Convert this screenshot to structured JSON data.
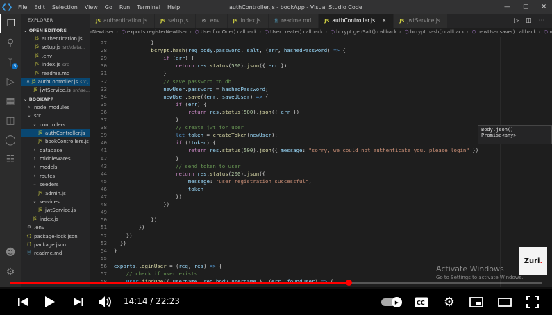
{
  "titlebar": {
    "menu": [
      "File",
      "Edit",
      "Selection",
      "View",
      "Go",
      "Run",
      "Terminal",
      "Help"
    ],
    "window_title": "authController.js - bookApp - Visual Studio Code"
  },
  "activity_badge": "5",
  "sidebar": {
    "title": "EXPLORER",
    "open_editors_header": "OPEN EDITORS",
    "open_editors": [
      {
        "name": "authentication.js",
        "desc": "",
        "selected": false
      },
      {
        "name": "setup.js",
        "desc": "src\\data...",
        "selected": false
      },
      {
        "name": ".env",
        "desc": "",
        "selected": false
      },
      {
        "name": "index.js",
        "desc": "src",
        "selected": false
      },
      {
        "name": "readme.md",
        "desc": "",
        "selected": false
      },
      {
        "name": "authController.js",
        "desc": "src\\...",
        "selected": true
      },
      {
        "name": "jwtService.js",
        "desc": "src\\se...",
        "selected": false
      }
    ],
    "project_header": "BOOKAPP",
    "tree": [
      {
        "name": "node_modules",
        "type": "folder",
        "depth": 1,
        "active": false
      },
      {
        "name": "src",
        "type": "folder-open",
        "depth": 1,
        "active": false
      },
      {
        "name": "controllers",
        "type": "folder-open",
        "depth": 2,
        "active": false
      },
      {
        "name": "authController.js",
        "type": "js",
        "depth": 3,
        "active": true
      },
      {
        "name": "bookControllers.js",
        "type": "js",
        "depth": 3,
        "active": false
      },
      {
        "name": "database",
        "type": "folder",
        "depth": 2,
        "active": false
      },
      {
        "name": "middlewares",
        "type": "folder",
        "depth": 2,
        "active": false
      },
      {
        "name": "models",
        "type": "folder",
        "depth": 2,
        "active": false
      },
      {
        "name": "routes",
        "type": "folder",
        "depth": 2,
        "active": false
      },
      {
        "name": "seeders",
        "type": "folder-open",
        "depth": 2,
        "active": false
      },
      {
        "name": "admin.js",
        "type": "js",
        "depth": 3,
        "active": false
      },
      {
        "name": "services",
        "type": "folder-open",
        "depth": 2,
        "active": false
      },
      {
        "name": "jwtService.js",
        "type": "js",
        "depth": 3,
        "active": false
      },
      {
        "name": "index.js",
        "type": "js",
        "depth": 2,
        "active": false
      },
      {
        "name": ".env",
        "type": "env",
        "depth": 1,
        "active": false
      },
      {
        "name": "package-lock.json",
        "type": "json",
        "depth": 1,
        "active": false
      },
      {
        "name": "package.json",
        "type": "json",
        "depth": 1,
        "active": false
      },
      {
        "name": "readme.md",
        "type": "md",
        "depth": 1,
        "active": false
      }
    ]
  },
  "tabs": [
    {
      "label": "authentication.js",
      "kind": "JS",
      "active": false
    },
    {
      "label": "setup.js",
      "kind": "JS",
      "active": false
    },
    {
      "label": ".env",
      "kind": "env",
      "active": false
    },
    {
      "label": "index.js",
      "kind": "JS",
      "active": false
    },
    {
      "label": "readme.md",
      "kind": "md",
      "active": false
    },
    {
      "label": "authController.js",
      "kind": "JS",
      "active": true
    },
    {
      "label": "jwtService.js",
      "kind": "JS",
      "active": false
    }
  ],
  "breadcrumbs": [
    "rNewUser",
    "exports.registerNewUser",
    "User.findOne() callback",
    "User.create() callback",
    "bcrypt.genSalt() callback",
    "bcrypt.hash() callback",
    "newUser.save() callback",
    "message"
  ],
  "code_lines": [
    {
      "num": "27",
      "tokens": [
        [
          "p",
          "            }"
        ]
      ]
    },
    {
      "num": "28",
      "tokens": [
        [
          "p",
          "            "
        ],
        [
          "f",
          "bcrypt"
        ],
        [
          "p",
          "."
        ],
        [
          "f",
          "hash"
        ],
        [
          "p",
          "("
        ],
        [
          "v",
          "req"
        ],
        [
          "p",
          "."
        ],
        [
          "v",
          "body"
        ],
        [
          "p",
          "."
        ],
        [
          "v",
          "password"
        ],
        [
          "p",
          ", "
        ],
        [
          "v",
          "salt"
        ],
        [
          "p",
          ", ("
        ],
        [
          "v",
          "err"
        ],
        [
          "p",
          ", "
        ],
        [
          "v",
          "hashedPassword"
        ],
        [
          "p",
          ") "
        ],
        [
          "k",
          "=>"
        ],
        [
          "p",
          " {"
        ]
      ]
    },
    {
      "num": "29",
      "tokens": [
        [
          "p",
          "                "
        ],
        [
          "kw",
          "if"
        ],
        [
          "p",
          " ("
        ],
        [
          "v",
          "err"
        ],
        [
          "p",
          ") {"
        ]
      ]
    },
    {
      "num": "30",
      "tokens": [
        [
          "p",
          "                    "
        ],
        [
          "kw",
          "return"
        ],
        [
          "p",
          " "
        ],
        [
          "v",
          "res"
        ],
        [
          "p",
          "."
        ],
        [
          "f",
          "status"
        ],
        [
          "p",
          "("
        ],
        [
          "n",
          "500"
        ],
        [
          "p",
          ")."
        ],
        [
          "f",
          "json"
        ],
        [
          "p",
          "({ "
        ],
        [
          "v",
          "err"
        ],
        [
          "p",
          " })"
        ]
      ]
    },
    {
      "num": "31",
      "tokens": [
        [
          "p",
          "                }"
        ]
      ]
    },
    {
      "num": "32",
      "tokens": [
        [
          "c",
          "                // save password to db"
        ]
      ]
    },
    {
      "num": "33",
      "tokens": [
        [
          "p",
          "                "
        ],
        [
          "v",
          "newUser"
        ],
        [
          "p",
          "."
        ],
        [
          "v",
          "password"
        ],
        [
          "p",
          " = "
        ],
        [
          "v",
          "hashedPassword"
        ],
        [
          "p",
          ";"
        ]
      ]
    },
    {
      "num": "34",
      "tokens": [
        [
          "p",
          "                "
        ],
        [
          "v",
          "newUser"
        ],
        [
          "p",
          "."
        ],
        [
          "f",
          "save"
        ],
        [
          "p",
          "(("
        ],
        [
          "v",
          "err"
        ],
        [
          "p",
          ", "
        ],
        [
          "v",
          "savedUser"
        ],
        [
          "p",
          ") "
        ],
        [
          "k",
          "=>"
        ],
        [
          "p",
          " {"
        ]
      ]
    },
    {
      "num": "35",
      "tokens": [
        [
          "p",
          "                    "
        ],
        [
          "kw",
          "if"
        ],
        [
          "p",
          " ("
        ],
        [
          "v",
          "err"
        ],
        [
          "p",
          ") {"
        ]
      ]
    },
    {
      "num": "36",
      "tokens": [
        [
          "p",
          "                        "
        ],
        [
          "kw",
          "return"
        ],
        [
          "p",
          " "
        ],
        [
          "v",
          "res"
        ],
        [
          "p",
          "."
        ],
        [
          "f",
          "status"
        ],
        [
          "p",
          "("
        ],
        [
          "n",
          "500"
        ],
        [
          "p",
          ")."
        ],
        [
          "f",
          "json"
        ],
        [
          "p",
          "({ "
        ],
        [
          "v",
          "err"
        ],
        [
          "p",
          " })"
        ]
      ]
    },
    {
      "num": "37",
      "tokens": [
        [
          "p",
          "                    }"
        ]
      ]
    },
    {
      "num": "38",
      "tokens": [
        [
          "c",
          "                    // create jwt for user"
        ]
      ]
    },
    {
      "num": "39",
      "tokens": [
        [
          "p",
          "                    "
        ],
        [
          "k",
          "let"
        ],
        [
          "p",
          " "
        ],
        [
          "v",
          "token"
        ],
        [
          "p",
          " = "
        ],
        [
          "f",
          "createToken"
        ],
        [
          "p",
          "("
        ],
        [
          "v",
          "newUser"
        ],
        [
          "p",
          ");"
        ]
      ]
    },
    {
      "num": "40",
      "tokens": [
        [
          "p",
          "                    "
        ],
        [
          "kw",
          "if"
        ],
        [
          "p",
          " (!"
        ],
        [
          "v",
          "token"
        ],
        [
          "p",
          ") {"
        ]
      ]
    },
    {
      "num": "41",
      "tokens": [
        [
          "p",
          "                        "
        ],
        [
          "kw",
          "return"
        ],
        [
          "p",
          " "
        ],
        [
          "v",
          "res"
        ],
        [
          "p",
          "."
        ],
        [
          "f",
          "status"
        ],
        [
          "p",
          "("
        ],
        [
          "n",
          "500"
        ],
        [
          "p",
          ")."
        ],
        [
          "f",
          "json"
        ],
        [
          "p",
          "({ "
        ],
        [
          "v",
          "message"
        ],
        [
          "p",
          ": "
        ],
        [
          "s",
          "\"sorry, we could not authenticate you. please login\""
        ],
        [
          "p",
          " })"
        ]
      ]
    },
    {
      "num": "42",
      "tokens": [
        [
          "p",
          "                    }"
        ]
      ]
    },
    {
      "num": "43",
      "tokens": [
        [
          "c",
          "                    // send token to user"
        ]
      ]
    },
    {
      "num": "44",
      "tokens": [
        [
          "p",
          "                    "
        ],
        [
          "kw",
          "return"
        ],
        [
          "p",
          " "
        ],
        [
          "v",
          "res"
        ],
        [
          "p",
          "."
        ],
        [
          "f",
          "status"
        ],
        [
          "p",
          "("
        ],
        [
          "n",
          "200"
        ],
        [
          "p",
          ")."
        ],
        [
          "f",
          "json"
        ],
        [
          "p",
          "({"
        ]
      ]
    },
    {
      "num": "45",
      "tokens": [
        [
          "p",
          "                        "
        ],
        [
          "v",
          "message"
        ],
        [
          "p",
          ": "
        ],
        [
          "s",
          "\"user registration successful\""
        ],
        [
          "p",
          ","
        ]
      ]
    },
    {
      "num": "46",
      "tokens": [
        [
          "p",
          "                        "
        ],
        [
          "v",
          "token"
        ]
      ]
    },
    {
      "num": "47",
      "tokens": [
        [
          "p",
          "                    })"
        ]
      ]
    },
    {
      "num": "48",
      "tokens": [
        [
          "p",
          "                })"
        ]
      ]
    },
    {
      "num": "49",
      "tokens": [
        [
          "p",
          ""
        ]
      ]
    },
    {
      "num": "50",
      "tokens": [
        [
          "p",
          "            })"
        ]
      ]
    },
    {
      "num": "51",
      "tokens": [
        [
          "p",
          "        })"
        ]
      ]
    },
    {
      "num": "52",
      "tokens": [
        [
          "p",
          "    })"
        ]
      ]
    },
    {
      "num": "53",
      "tokens": [
        [
          "p",
          "  })"
        ]
      ]
    },
    {
      "num": "54",
      "tokens": [
        [
          "p",
          "}"
        ]
      ]
    },
    {
      "num": "55",
      "tokens": [
        [
          "p",
          ""
        ]
      ]
    },
    {
      "num": "56",
      "tokens": [
        [
          "v",
          "exports"
        ],
        [
          "p",
          "."
        ],
        [
          "f",
          "loginUser"
        ],
        [
          "p",
          " = ("
        ],
        [
          "v",
          "req"
        ],
        [
          "p",
          ", "
        ],
        [
          "v",
          "res"
        ],
        [
          "p",
          ") "
        ],
        [
          "k",
          "=>"
        ],
        [
          "p",
          " {"
        ]
      ]
    },
    {
      "num": "57",
      "tokens": [
        [
          "c",
          "    // check if user exists"
        ]
      ]
    },
    {
      "num": "58",
      "tokens": [
        [
          "p",
          "    "
        ],
        [
          "cl",
          "User"
        ],
        [
          "p",
          "."
        ],
        [
          "f",
          "findOne"
        ],
        [
          "p",
          "({ "
        ],
        [
          "v",
          "username"
        ],
        [
          "p",
          ": "
        ],
        [
          "v",
          "req"
        ],
        [
          "p",
          "."
        ],
        [
          "v",
          "body"
        ],
        [
          "p",
          "."
        ],
        [
          "v",
          "username"
        ],
        [
          "p",
          " }, ("
        ],
        [
          "v",
          "err"
        ],
        [
          "p",
          ", "
        ],
        [
          "v",
          "foundUser"
        ],
        [
          "p",
          ") "
        ],
        [
          "k",
          "=>"
        ],
        [
          "p",
          " {"
        ]
      ]
    }
  ],
  "hover": {
    "line1": "Body.json():",
    "line2": "Promise<any>"
  },
  "watermark": {
    "title": "Activate Windows",
    "subtitle": "Go to Settings to activate Windows."
  },
  "zuri_logo": "Zuri",
  "player": {
    "time_current": "14:14",
    "time_separator": "/",
    "time_total": "22:23",
    "played_fraction": 0.636,
    "loaded_fraction": 0.64,
    "icons": [
      "previous-icon",
      "play-icon",
      "next-icon",
      "volume-icon",
      "autoplay-toggle",
      "captions-icon",
      "settings-icon",
      "miniplayer-icon",
      "theater-icon",
      "fullscreen-icon"
    ]
  }
}
